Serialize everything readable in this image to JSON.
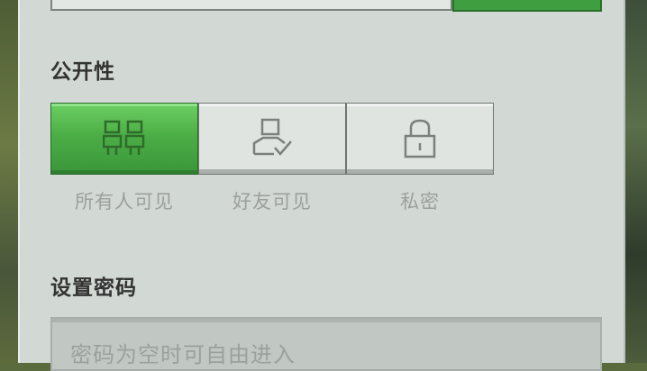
{
  "visibility": {
    "title": "公开性",
    "options": [
      {
        "label": "所有人可见",
        "icon": "people-icon",
        "selected": true
      },
      {
        "label": "好友可见",
        "icon": "friend-icon",
        "selected": false
      },
      {
        "label": "私密",
        "icon": "lock-icon",
        "selected": false
      }
    ]
  },
  "password": {
    "title": "设置密码",
    "placeholder": "密码为空时可自由进入"
  },
  "colors": {
    "accent": "#4cae46",
    "panel": "#d2d8d4"
  }
}
